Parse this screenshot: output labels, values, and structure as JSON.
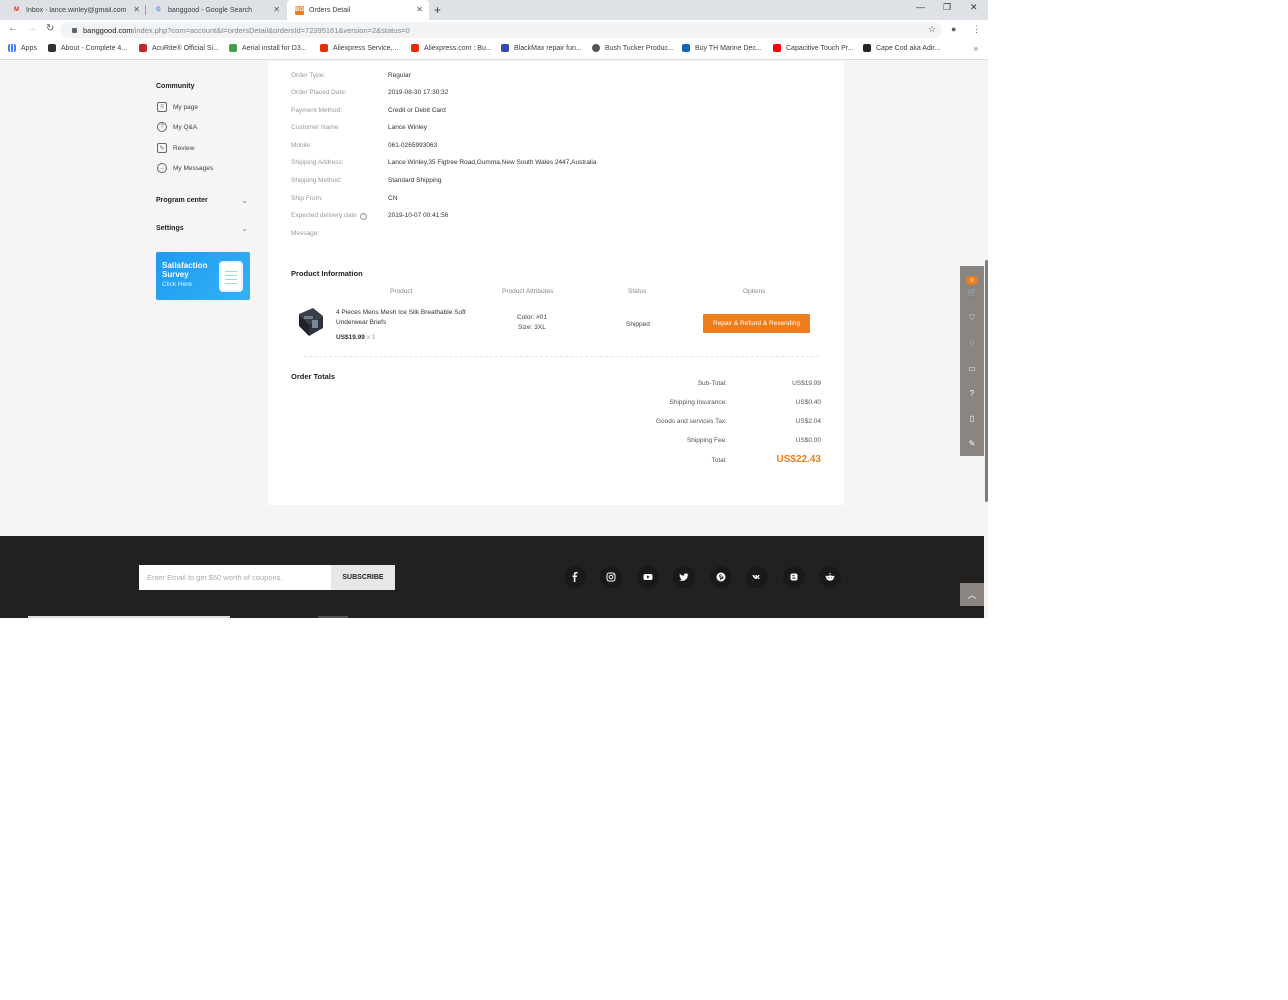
{
  "browser": {
    "tabs": [
      {
        "title": "Inbox - lance.winley@gmail.com",
        "favicon": "gmail-icon",
        "active": false
      },
      {
        "title": "banggood - Google Search",
        "favicon": "google-icon",
        "active": false
      },
      {
        "title": "Orders Detail",
        "favicon": "banggood-icon",
        "active": true
      }
    ],
    "url_host": "banggood.com",
    "url_path": "/index.php?com=account&t=ordersDetail&ordersId=72395161&version=2&status=0",
    "bookmarks": [
      "Apps",
      "About - Complete 4...",
      "AcuRite® Official Si...",
      "Aerial install for D3...",
      "Aliexpress Service,...",
      "Aliexpress.com : Bu...",
      "BlackMax repair fun...",
      "Bush Tucker Produc...",
      "Buy TH Marine Dec...",
      "Capacitive Touch Pr...",
      "Cape Cod aka Adir..."
    ]
  },
  "sidebar": {
    "community_heading": "Community",
    "items": [
      {
        "label": "My page",
        "icon": "page-icon"
      },
      {
        "label": "My Q&A",
        "icon": "question-icon"
      },
      {
        "label": "Review",
        "icon": "review-icon"
      },
      {
        "label": "My Messages",
        "icon": "message-icon"
      }
    ],
    "program_center": "Program center",
    "settings": "Settings",
    "survey": {
      "line1": "Satisfaction",
      "line2": "Survey",
      "cta": "Click Here"
    }
  },
  "order": {
    "rows": [
      {
        "label": "Order Type:",
        "value": "Regular"
      },
      {
        "label": "Order Placed Date:",
        "value": "2019-08-30 17:30:32"
      },
      {
        "label": "Payment Method:",
        "value": "Credit or Debit Card"
      },
      {
        "label": "Customer Name",
        "value": "Lance Winley"
      },
      {
        "label": "Mobile:",
        "value": "061-0265993063"
      },
      {
        "label": "Shipping Address:",
        "value": "Lance Winley,35 Figtree Road,Gumma,New South Wales 2447,Australia"
      },
      {
        "label": "Shipping Method:",
        "value": "Standard Shipping"
      },
      {
        "label": "Ship From:",
        "value": "CN"
      },
      {
        "label": "Expected delivery date",
        "value": "2019-10-07 00:41:56"
      },
      {
        "label": "Message:",
        "value": ""
      }
    ]
  },
  "product_info": {
    "title": "Product Information",
    "headers": {
      "product": "Product",
      "attributes": "Product Attributes",
      "status": "Status",
      "options": "Options"
    },
    "item": {
      "name": "4 Pieces Mens Mesh Ice Silk Breathable Soft Underwear Briefs",
      "price": "US$19.99",
      "qty": "x 1",
      "color": "Color: #01",
      "size": "Size: 3XL",
      "status": "Shipped",
      "action": "Repair & Refund & Resending"
    }
  },
  "totals": {
    "title": "Order Totals",
    "rows": [
      {
        "label": "Sub-Total:",
        "value": "US$19.99"
      },
      {
        "label": "Shipping Insurance:",
        "value": "US$0.40"
      },
      {
        "label": "Goods and services Tax:",
        "value": "US$2.04"
      },
      {
        "label": "Shipping Fee:",
        "value": "US$0.00"
      }
    ],
    "total_label": "Total:",
    "total_value": "US$22.43"
  },
  "floatbar": {
    "cart_count": "0"
  },
  "footer": {
    "email_placeholder": "Enter Email to get $50 worth of coupons.",
    "subscribe": "SUBSCRIBE",
    "social": [
      "facebook-icon",
      "instagram-icon",
      "youtube-icon",
      "twitter-icon",
      "pinterest-icon",
      "vk-icon",
      "blogger-icon",
      "reddit-icon"
    ]
  },
  "colors": {
    "accent": "#ee7d1b",
    "survey_blue": "#1d9bf0",
    "footer_bg": "#232120"
  }
}
